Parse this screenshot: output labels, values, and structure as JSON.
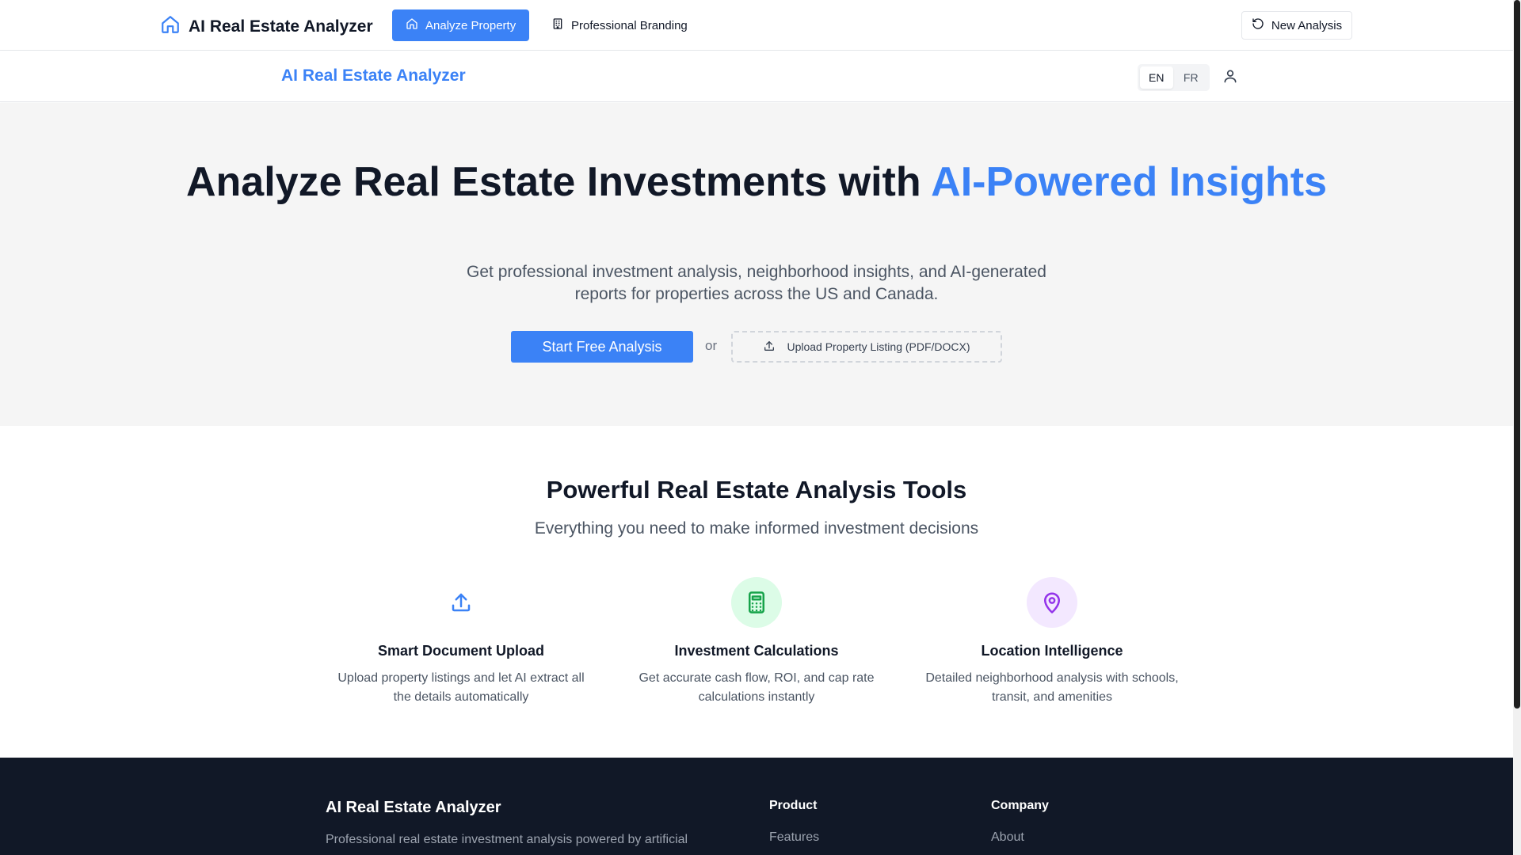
{
  "topbar": {
    "brand_title": "AI Real Estate Analyzer",
    "brand_icon": "home-icon",
    "nav": {
      "analyze_label": "Analyze Property",
      "branding_label": "Professional Branding"
    },
    "new_analysis_label": "New Analysis"
  },
  "subheader": {
    "brand_title": "AI Real Estate Analyzer",
    "languages": [
      "EN",
      "FR"
    ],
    "active_language": "EN"
  },
  "hero": {
    "title_main": "Analyze Real Estate Investments with ",
    "title_accent": "AI-Powered Insights",
    "subtitle": "Get professional investment analysis, neighborhood insights, and AI-generated reports for properties across the US and Canada.",
    "start_label": "Start Free Analysis",
    "or_label": "or",
    "upload_label": "Upload Property Listing (PDF/DOCX)"
  },
  "features": {
    "title": "Powerful Real Estate Analysis Tools",
    "subtitle": "Everything you need to make informed investment decisions",
    "items": [
      {
        "title": "Smart Document Upload",
        "description": "Upload property listings and let AI extract all the details automatically",
        "icon": "upload-icon",
        "color": "#3b82f6"
      },
      {
        "title": "Investment Calculations",
        "description": "Get accurate cash flow, ROI, and cap rate calculations instantly",
        "icon": "calculator-icon",
        "color": "#16a34a"
      },
      {
        "title": "Location Intelligence",
        "description": "Detailed neighborhood analysis with schools, transit, and amenities",
        "icon": "map-pin-icon",
        "color": "#9333ea"
      }
    ]
  },
  "footer": {
    "brand_title": "AI Real Estate Analyzer",
    "description": "Professional real estate investment analysis powered by artificial",
    "product_title": "Product",
    "product_link": "Features",
    "company_title": "Company",
    "company_link": "About"
  },
  "colors": {
    "accent": "#3b82f6",
    "dark": "#111827",
    "hero_bg": "#f5f5f5"
  }
}
